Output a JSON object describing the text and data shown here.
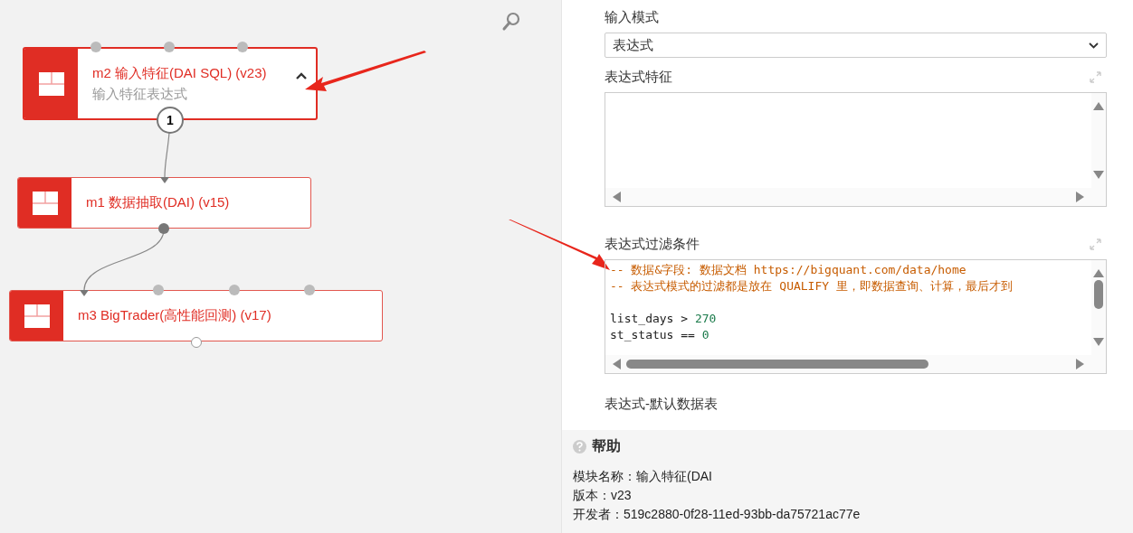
{
  "canvas": {
    "nodes": [
      {
        "title": "m2 输入特征(DAI SQL) (v23)",
        "subtitle": "输入特征表达式",
        "selected": true,
        "output_badge": "1"
      },
      {
        "title": "m1 数据抽取(DAI) (v15)",
        "selected": false
      },
      {
        "title": "m3 BigTrader(高性能回测) (v17)",
        "selected": false
      }
    ]
  },
  "properties": {
    "fields": [
      {
        "kind": "select",
        "label": "输入模式",
        "value": "表达式"
      },
      {
        "kind": "code",
        "label": "表达式特征"
      },
      {
        "kind": "code",
        "label": "表达式过滤条件",
        "lines": [
          {
            "kind": "comment",
            "text": "-- 数据&字段: 数据文档 https://bigquant.com/data/home"
          },
          {
            "kind": "comment",
            "text": "-- 表达式模式的过滤都是放在 QUALIFY 里，即数据查询、计算，最后才到"
          },
          {
            "kind": "blank"
          },
          {
            "kind": "code",
            "text": "list_days >",
            "number": "270"
          },
          {
            "kind": "code",
            "text": "st_status ==",
            "number": "0"
          }
        ]
      },
      {
        "kind": "label",
        "label": "表达式-默认数据表"
      }
    ]
  },
  "help": {
    "title": "帮助",
    "lines": [
      "模块名称：输入特征(DAI",
      "版本：v23",
      "开发者：519c2880-0f28-11ed-93bb-da75721ac77e"
    ]
  }
}
